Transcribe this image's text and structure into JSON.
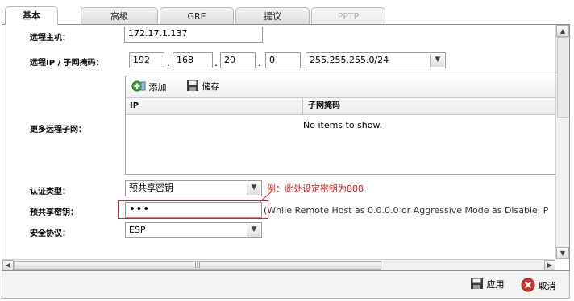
{
  "tabs": [
    {
      "label": "基本",
      "state": "active"
    },
    {
      "label": "高级",
      "state": "normal"
    },
    {
      "label": "GRE",
      "state": "normal"
    },
    {
      "label": "提议",
      "state": "normal"
    },
    {
      "label": "PPTP",
      "state": "disabled"
    }
  ],
  "form": {
    "remote_host": {
      "label": "远程主机：",
      "value": "172.17.1.137"
    },
    "remote_ip": {
      "label": "远程IP / 子网掩码：",
      "octets": [
        "192",
        "168",
        "20",
        "0"
      ],
      "separator": ".",
      "mask": "255.255.255.0/24"
    },
    "more_subnets": {
      "label": "更多远程子网："
    },
    "auth_type": {
      "label": "认证类型：",
      "value": "预共享密钥"
    },
    "psk": {
      "label": "预共享密钥：",
      "value": "•••",
      "hint": "(While Remote Host as 0.0.0.0 or Aggressive Mode as Disable, P"
    },
    "protocol": {
      "label": "安全协议：",
      "value": "ESP"
    }
  },
  "grid": {
    "add_label": "添加",
    "save_label": "储存",
    "columns": [
      "IP",
      "子网掩码"
    ],
    "empty_text": "No items to show."
  },
  "annotation": {
    "text": "例：此处设定密钥为888",
    "color": "#e02020"
  },
  "footer": {
    "apply_label": "应用",
    "cancel_label": "取消"
  },
  "icons": {
    "add": "add-icon",
    "save": "save-icon",
    "apply": "apply-icon",
    "cancel": "cancel-icon",
    "dropdown": "chevron-down-icon"
  }
}
